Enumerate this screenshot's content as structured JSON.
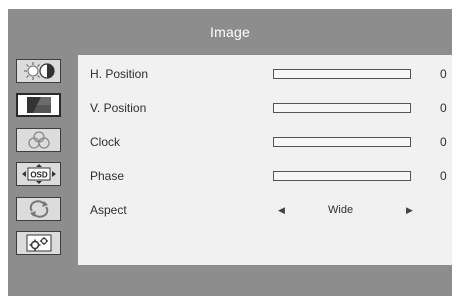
{
  "header": {
    "title": "Image"
  },
  "sidebar": {
    "items": [
      {
        "icon": "brightness-contrast-icon",
        "active": false
      },
      {
        "icon": "image-icon",
        "active": true
      },
      {
        "icon": "color-icon",
        "active": false
      },
      {
        "icon": "osd-icon",
        "active": false,
        "text": "OSD"
      },
      {
        "icon": "reset-icon",
        "active": false
      },
      {
        "icon": "setup-icon",
        "active": false
      }
    ]
  },
  "menu": {
    "items": [
      {
        "label": "H. Position",
        "value": "0",
        "level": 0
      },
      {
        "label": "V. Position",
        "value": "0",
        "level": 0
      },
      {
        "label": "Clock",
        "value": "0",
        "level": 0
      },
      {
        "label": "Phase",
        "value": "0",
        "level": 0
      },
      {
        "label": "Aspect",
        "option": "Wide"
      }
    ]
  },
  "colors": {
    "frame": "#8d8d8d",
    "content": "#f1f1f1"
  }
}
